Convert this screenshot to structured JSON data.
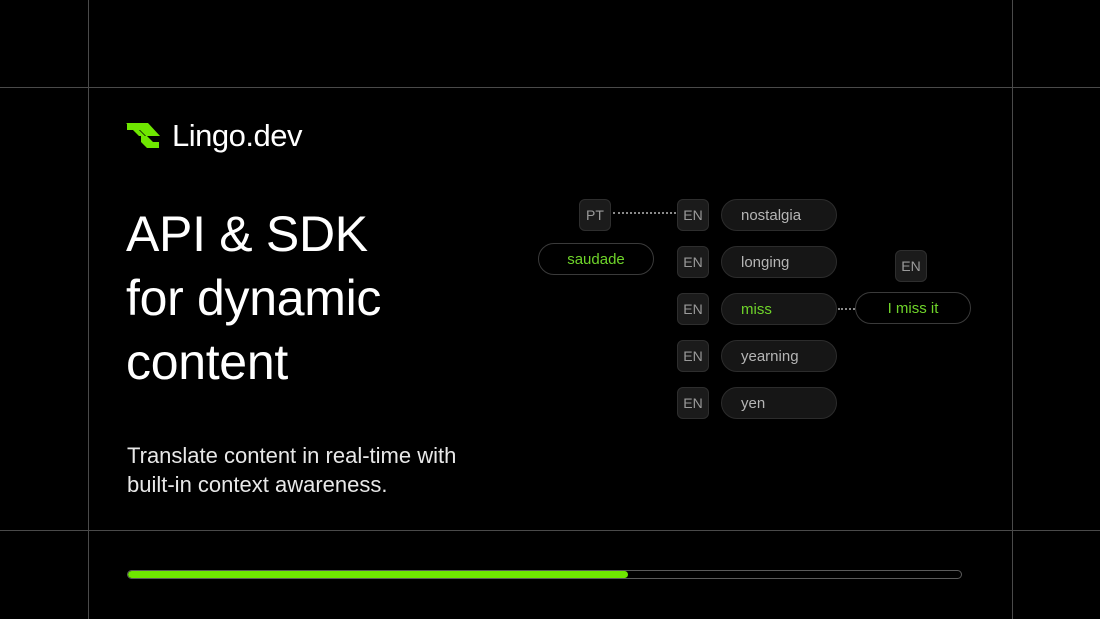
{
  "brand": {
    "name": "Lingo.dev",
    "logo_icon": "lingo-logo-icon",
    "accent_color": "#6ee600"
  },
  "headline": {
    "lines": [
      "API & SDK",
      "for dynamic",
      "content"
    ]
  },
  "subtitle": {
    "lines": [
      "Translate content in real-time with",
      "built-in context awareness."
    ]
  },
  "diagram": {
    "source": {
      "lang": "PT",
      "word": "saudade"
    },
    "candidates": [
      {
        "lang": "EN",
        "word": "nostalgia",
        "selected": false
      },
      {
        "lang": "EN",
        "word": "longing",
        "selected": false
      },
      {
        "lang": "EN",
        "word": "miss",
        "selected": true
      },
      {
        "lang": "EN",
        "word": "yearning",
        "selected": false
      },
      {
        "lang": "EN",
        "word": "yen",
        "selected": false
      }
    ],
    "result": {
      "lang": "EN",
      "text": "I miss it"
    }
  },
  "progress": {
    "value_percent": 60
  }
}
